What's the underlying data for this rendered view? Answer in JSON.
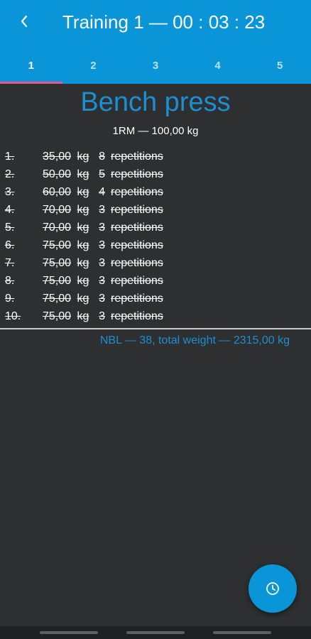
{
  "appbar": {
    "back_icon": "chevron-left-icon",
    "title": "Training 1 — 00 : 03 : 23",
    "background_color": "#0a95d8"
  },
  "tabs": [
    {
      "label": "1",
      "active": true
    },
    {
      "label": "2",
      "active": false
    },
    {
      "label": "3",
      "active": false
    },
    {
      "label": "4",
      "active": false
    },
    {
      "label": "5",
      "active": false
    }
  ],
  "tab_indicator_color": "#e45a8e",
  "exercise": {
    "name": "Bench press",
    "one_rm": "1RM — 100,00 kg"
  },
  "sets": [
    {
      "num": "1.",
      "weight": "35,00",
      "unit": "kg",
      "reps": "8",
      "label": "repetitions",
      "completed": true
    },
    {
      "num": "2.",
      "weight": "50,00",
      "unit": "kg",
      "reps": "5",
      "label": "repetitions",
      "completed": true
    },
    {
      "num": "3.",
      "weight": "60,00",
      "unit": "kg",
      "reps": "4",
      "label": "repetitions",
      "completed": true
    },
    {
      "num": "4.",
      "weight": "70,00",
      "unit": "kg",
      "reps": "3",
      "label": "repetitions",
      "completed": true
    },
    {
      "num": "5.",
      "weight": "70,00",
      "unit": "kg",
      "reps": "3",
      "label": "repetitions",
      "completed": true
    },
    {
      "num": "6.",
      "weight": "75,00",
      "unit": "kg",
      "reps": "3",
      "label": "repetitions",
      "completed": true
    },
    {
      "num": "7.",
      "weight": "75,00",
      "unit": "kg",
      "reps": "3",
      "label": "repetitions",
      "completed": true
    },
    {
      "num": "8.",
      "weight": "75,00",
      "unit": "kg",
      "reps": "3",
      "label": "repetitions",
      "completed": true
    },
    {
      "num": "9.",
      "weight": "75,00",
      "unit": "kg",
      "reps": "3",
      "label": "repetitions",
      "completed": true
    },
    {
      "num": "10.",
      "weight": "75,00",
      "unit": "kg",
      "reps": "3",
      "label": "repetitions",
      "completed": true
    }
  ],
  "summary": "NBL — 38, total weight — 2315,00 kg",
  "accent_color": "#1d8fd0",
  "fab": {
    "icon": "clock-icon"
  }
}
